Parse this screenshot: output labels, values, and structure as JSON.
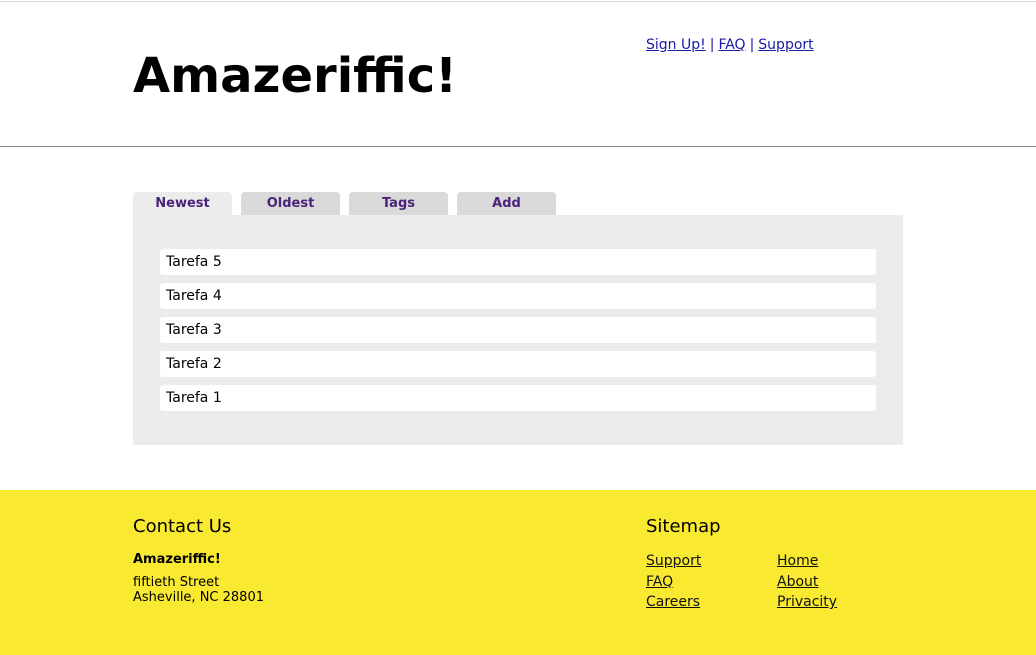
{
  "header": {
    "logo": "Amazeriffic!",
    "links": [
      "Sign Up!",
      "FAQ",
      "Support"
    ],
    "separator": "|"
  },
  "tabs": [
    {
      "label": "Newest",
      "active": true
    },
    {
      "label": "Oldest",
      "active": false
    },
    {
      "label": "Tags",
      "active": false
    },
    {
      "label": "Add",
      "active": false
    }
  ],
  "tasks": [
    "Tarefa 5",
    "Tarefa 4",
    "Tarefa 3",
    "Tarefa 2",
    "Tarefa 1"
  ],
  "footer": {
    "contact": {
      "title": "Contact Us",
      "name": "Amazeriffic!",
      "street": "fiftieth Street",
      "city": "Asheville, NC 28801"
    },
    "sitemap": {
      "title": "Sitemap",
      "col1": [
        "Support",
        "FAQ",
        "Careers"
      ],
      "col2": [
        "Home",
        "About",
        "Privacity"
      ]
    }
  },
  "colors": {
    "footer_bg": "#f9e930",
    "tab_text": "#4b237a",
    "link": "#1a1aa6"
  }
}
